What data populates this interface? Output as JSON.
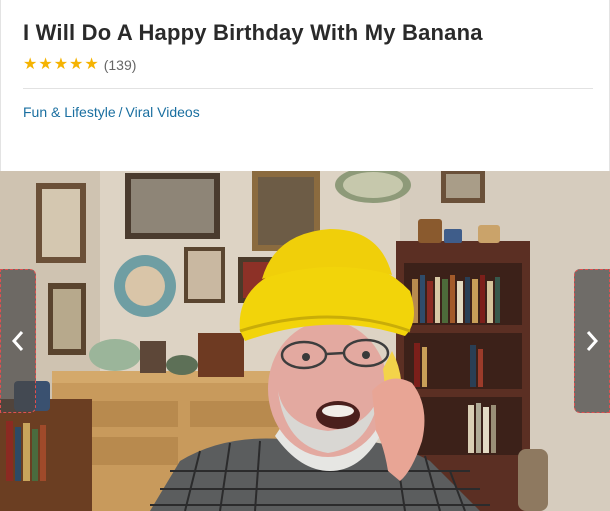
{
  "video_page": {
    "title": "I Will Do A Happy Birthday With My Banana",
    "rating": {
      "stars": 5,
      "count_label": "(139)"
    },
    "breadcrumb": {
      "category": "Fun & Lifestyle",
      "separator": "/",
      "subcategory": "Viral Videos"
    }
  },
  "carousel": {
    "prev_icon": "chevron-left-icon",
    "next_icon": "chevron-right-icon"
  },
  "colors": {
    "link": "#1a6fa0",
    "star": "#f5b301",
    "hat": "#f2d40a",
    "banana": "#f3d34a"
  }
}
